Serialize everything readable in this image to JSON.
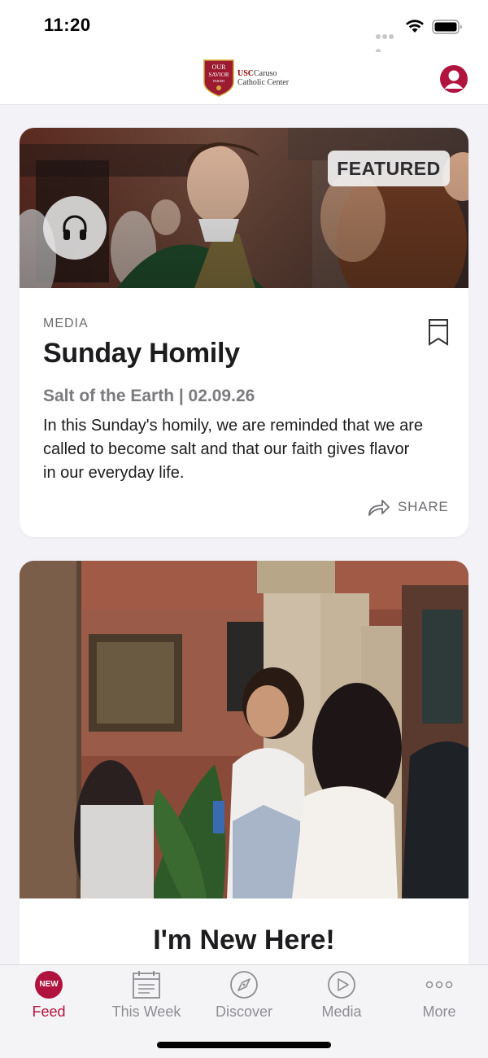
{
  "status_bar": {
    "time": "11:20"
  },
  "header": {
    "logo": {
      "shield_lines": [
        "OUR",
        "SAVIOR",
        "PARISH"
      ],
      "brand_prefix": "USC",
      "brand_line1": "Caruso",
      "brand_line2": "Catholic Center"
    },
    "profile_icon": "person-icon"
  },
  "feed": {
    "cards": [
      {
        "badge": "FEATURED",
        "audio_icon": "headphones-icon",
        "category": "MEDIA",
        "title": "Sunday Homily",
        "subtitle": "Salt of the Earth | 02.09.26",
        "body": "In this Sunday's homily, we are reminded that we are called to become salt and that our faith gives flavor in our everyday life.",
        "share_label": "SHARE",
        "bookmark_icon": "bookmark-icon"
      },
      {
        "title": "I'm New Here!"
      }
    ]
  },
  "tab_bar": {
    "tabs": [
      {
        "label": "Feed",
        "badge": "NEW",
        "icon": "new-badge",
        "active": true
      },
      {
        "label": "This Week",
        "icon": "calendar-icon",
        "active": false
      },
      {
        "label": "Discover",
        "icon": "compass-icon",
        "active": false
      },
      {
        "label": "Media",
        "icon": "play-circle-icon",
        "active": false
      },
      {
        "label": "More",
        "icon": "more-dots-icon",
        "active": false
      }
    ]
  },
  "colors": {
    "accent": "#b0133e",
    "background": "#f2f2f7",
    "card": "#ffffff",
    "muted_text": "#6d6d72"
  }
}
